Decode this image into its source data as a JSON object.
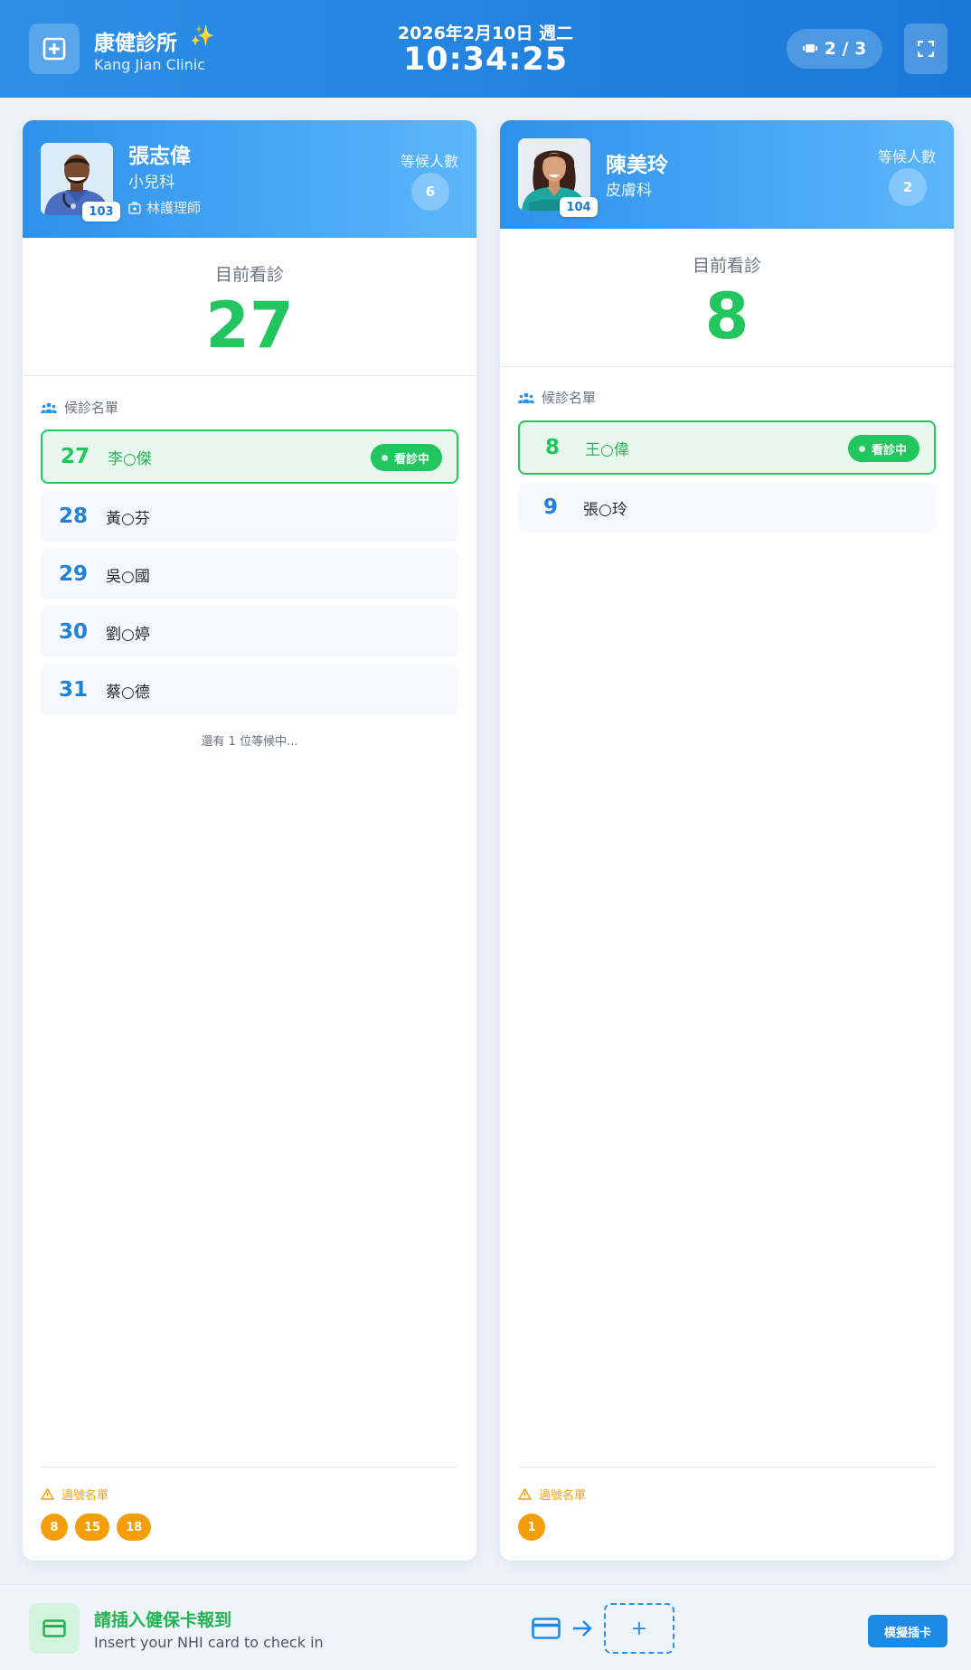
{
  "header": {
    "clinic_name": "康健診所",
    "clinic_sparkle": "✨",
    "clinic_en": "Kang Jian Clinic",
    "date": "2026年2月10日 週二",
    "time": "10:34:25",
    "page_indicator": "2 / 3"
  },
  "doctors": [
    {
      "name": "張志偉",
      "department": "小兒科",
      "nurse": "林護理師",
      "room": "103",
      "waiting_label": "等候人數",
      "waiting_count": "6",
      "now_label": "目前看診",
      "now_number": "27",
      "list_title": "候診名單",
      "queue": [
        {
          "number": "27",
          "name": "李○傑",
          "status": "看診中"
        },
        {
          "number": "28",
          "name": "黃○芬"
        },
        {
          "number": "29",
          "name": "吳○國"
        },
        {
          "number": "30",
          "name": "劉○婷"
        },
        {
          "number": "31",
          "name": "蔡○德"
        }
      ],
      "more_note": "還有 1 位等候中...",
      "missed_title": "過號名單",
      "missed": [
        "8",
        "15",
        "18"
      ]
    },
    {
      "name": "陳美玲",
      "department": "皮膚科",
      "room": "104",
      "waiting_label": "等候人數",
      "waiting_count": "2",
      "now_label": "目前看診",
      "now_number": "8",
      "list_title": "候診名單",
      "queue": [
        {
          "number": "8",
          "name": "王○偉",
          "status": "看診中"
        },
        {
          "number": "9",
          "name": "張○玲"
        }
      ],
      "missed_title": "過號名單",
      "missed": [
        "1"
      ]
    }
  ],
  "footer": {
    "title": "請插入健保卡報到",
    "subtitle": "Insert your NHI card to check in",
    "slot_symbol": "+",
    "simulate_button": "模擬插卡"
  },
  "colors": {
    "header_blue": "#1a78d8",
    "serving_green": "#22c55e",
    "queue_blue": "#2181d8",
    "missed_orange": "#f59e0b"
  },
  "icons": [
    "plus-square-icon",
    "sparkle-icon",
    "tv-icon",
    "fullscreen-icon",
    "nurse-badge-icon",
    "users-icon",
    "warning-icon",
    "credit-card-icon",
    "arrow-right-icon"
  ]
}
